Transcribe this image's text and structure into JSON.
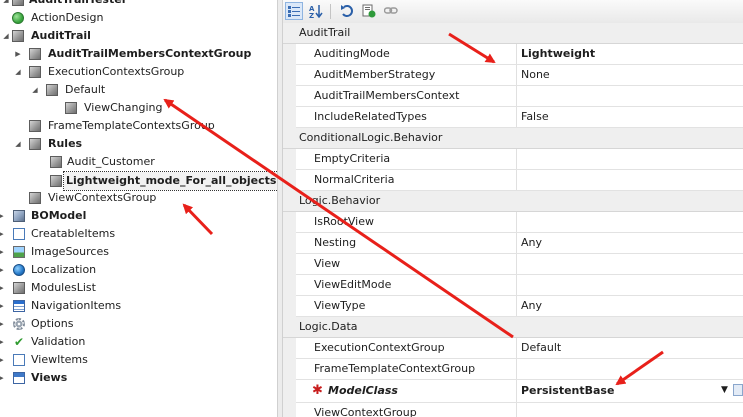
{
  "tree": {
    "items": [
      {
        "label": "AuditTrailTester",
        "bold": true
      },
      {
        "label": "ActionDesign",
        "bold": false
      },
      {
        "label": "AuditTrail",
        "bold": true
      },
      {
        "label": "AuditTrailMembersContextGroup",
        "bold": true
      },
      {
        "label": "ExecutionContextsGroup",
        "bold": false
      },
      {
        "label": "Default",
        "bold": false
      },
      {
        "label": "ViewChanging",
        "bold": false
      },
      {
        "label": "FrameTemplateContextsGroup",
        "bold": false
      },
      {
        "label": "Rules",
        "bold": true
      },
      {
        "label": "Audit_Customer",
        "bold": false
      },
      {
        "label": "Lightweight_mode_For_all_objects",
        "bold": true,
        "selected": true
      },
      {
        "label": "ViewContextsGroup",
        "bold": false
      },
      {
        "label": "BOModel",
        "bold": true
      },
      {
        "label": "CreatableItems",
        "bold": false
      },
      {
        "label": "ImageSources",
        "bold": false
      },
      {
        "label": "Localization",
        "bold": false
      },
      {
        "label": "ModulesList",
        "bold": false
      },
      {
        "label": "NavigationItems",
        "bold": false
      },
      {
        "label": "Options",
        "bold": false
      },
      {
        "label": "Validation",
        "bold": false
      },
      {
        "label": "ViewItems",
        "bold": false
      },
      {
        "label": "Views",
        "bold": true
      }
    ],
    "icons": {
      "expanded": "triangle-down",
      "collapsed": "triangle-right"
    }
  },
  "toolbar": {
    "buttons": [
      "categorized-icon",
      "alphabetical-icon",
      "undo-icon",
      "reset-icon",
      "link-icon"
    ]
  },
  "properties": {
    "categories": [
      {
        "name": "AuditTrail",
        "rows": [
          {
            "name": "AuditingMode",
            "value": "Lightweight",
            "bold": true
          },
          {
            "name": "AuditMemberStrategy",
            "value": "None"
          },
          {
            "name": "AuditTrailMembersContext",
            "value": ""
          },
          {
            "name": "IncludeRelatedTypes",
            "value": "False"
          }
        ]
      },
      {
        "name": "ConditionalLogic.Behavior",
        "rows": [
          {
            "name": "EmptyCriteria",
            "value": ""
          },
          {
            "name": "NormalCriteria",
            "value": ""
          }
        ]
      },
      {
        "name": "Logic.Behavior",
        "rows": [
          {
            "name": "IsRootView",
            "value": ""
          },
          {
            "name": "Nesting",
            "value": "Any"
          },
          {
            "name": "View",
            "value": ""
          },
          {
            "name": "ViewEditMode",
            "value": ""
          },
          {
            "name": "ViewType",
            "value": "Any"
          }
        ]
      },
      {
        "name": "Logic.Data",
        "rows": [
          {
            "name": "ExecutionContextGroup",
            "value": "Default"
          },
          {
            "name": "FrameTemplateContextGroup",
            "value": ""
          },
          {
            "name": "ModelClass",
            "value": "PersistentBase",
            "bold": true,
            "required": true,
            "dropdown": true
          },
          {
            "name": "ViewContextGroup",
            "value": ""
          }
        ]
      }
    ]
  },
  "colors": {
    "arrow": "#e8201a",
    "category_bg": "#efefef",
    "required_marker": "#c81e1e"
  }
}
